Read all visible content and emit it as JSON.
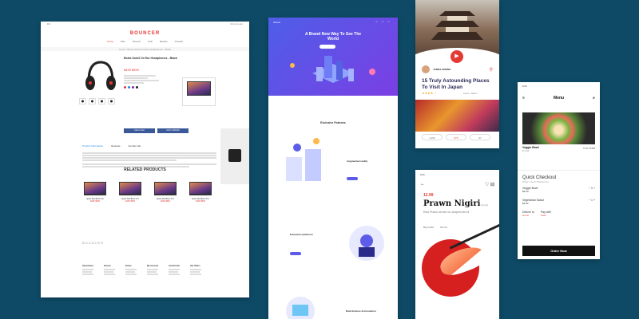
{
  "ecommerce": {
    "logo": "BOUNCER",
    "nav": [
      "Home",
      "Men",
      "Women",
      "Kids",
      "Brands",
      "Contact"
    ],
    "breadcrumb": "Home / Beats Solo3 On-Ear Headphones - Black",
    "product_title": "Beats Solo3 On Ear Headphones - Black",
    "price": "$499 $599",
    "buttons": [
      "Add to Cart",
      "Add to Wishlist"
    ],
    "tabs": [
      "Product Information",
      "Reviews",
      "Another tab"
    ],
    "related_title": "RELATED PRODUCTS",
    "related": [
      {
        "name": "Apple MacBook Pro",
        "price": "$499 $599"
      },
      {
        "name": "Apple MacBook Pro",
        "price": "$499 $599"
      },
      {
        "name": "Apple MacBook Pro",
        "price": "$499 $599"
      },
      {
        "name": "Apple MacBook Pro",
        "price": "$499 $599"
      }
    ],
    "footer_logo": "BOUNCER",
    "footer_cols": [
      "Information",
      "Service",
      "Extras",
      "My Account",
      "Userful Info",
      "Our Offers"
    ]
  },
  "landing": {
    "brand": "Olivine",
    "hero_title": "A Brand New Way To See The World",
    "section_title": "Exclusive Features",
    "feature1": "Augmented reality",
    "feature2": "Education platforms",
    "feature3": "Data Science & Innovation"
  },
  "travel": {
    "author": "JAMES ORBNO",
    "title": "15 Truly Astounding Places To Visit In Japan",
    "rating": "★★★★☆",
    "location": "Kyoto, Japan",
    "actions": [
      "1,231",
      "870",
      "37"
    ]
  },
  "sushi": {
    "time": "9:41",
    "price": "12.99",
    "name": "Prawn Nigiri",
    "qty": "(2 pcs)",
    "sub": "Raw Prawn served on shaped bed of",
    "meta": [
      "Big Crabs",
      "60 min"
    ]
  },
  "menu": {
    "time": "9:41",
    "title": "Menu",
    "item_name": "Veggie Bowl",
    "item_price": "$ 4.92",
    "item_cta": "1 in Cart",
    "checkout_title": "Quick Checkout",
    "checkout_sub": "Order List (6 Total items)",
    "rows": [
      {
        "name": "Veggie Bowl",
        "price": "$9.20",
        "qty": "1"
      },
      {
        "name": "Vegetarian Salad",
        "price": "$4.92",
        "qty": "1"
      }
    ],
    "deliver_label": "Deliver to",
    "deliver_value": "Home",
    "pay_label": "Pay with",
    "pay_value": "Cash",
    "order_button": "Order Now"
  },
  "colors": {
    "background": "#0e4a66",
    "accent_red": "#e53935",
    "landing_purple": "#5c5ce8"
  }
}
